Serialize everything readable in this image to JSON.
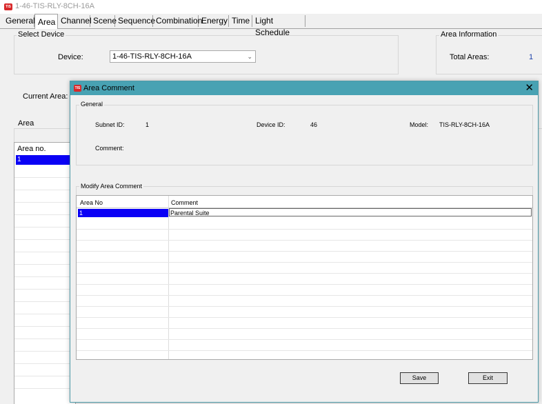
{
  "window": {
    "title": "1-46-TIS-RLY-8CH-16A",
    "logo_text": "TIS"
  },
  "tabs": [
    "General",
    "Area",
    "Channel",
    "Scene",
    "Sequence",
    "Combination",
    "Energy",
    "Time",
    "Light Schedule"
  ],
  "active_tab": "Area",
  "select_device": {
    "group_label": "Select Device",
    "device_label": "Device:",
    "device_value": "1-46-TIS-RLY-8CH-16A"
  },
  "area_information": {
    "group_label": "Area Information",
    "total_areas_label": "Total Areas:",
    "total_areas_value": "1"
  },
  "current_area_label": "Current Area:",
  "area_group_label": "Area",
  "area_grid": {
    "header": "Area no.",
    "rows": [
      "1"
    ]
  },
  "dialog": {
    "title": "Area Comment",
    "logo_text": "TIS",
    "close_glyph": "✕",
    "general": {
      "group_label": "General",
      "subnet_id_label": "Subnet ID:",
      "subnet_id_value": "1",
      "device_id_label": "Device ID:",
      "device_id_value": "46",
      "model_label": "Model:",
      "model_value": "TIS-RLY-8CH-16A",
      "comment_label": "Comment:"
    },
    "modify": {
      "group_label": "Modify Area Comment",
      "columns": [
        "Area No",
        "Comment"
      ],
      "rows": [
        {
          "area_no": "1",
          "comment": "Parental Suite"
        }
      ]
    },
    "buttons": {
      "save": "Save",
      "exit": "Exit"
    }
  },
  "colors": {
    "dialog_title_bar": "#48a2b3",
    "selection": "#0a00f5",
    "logo": "#d8282a"
  }
}
